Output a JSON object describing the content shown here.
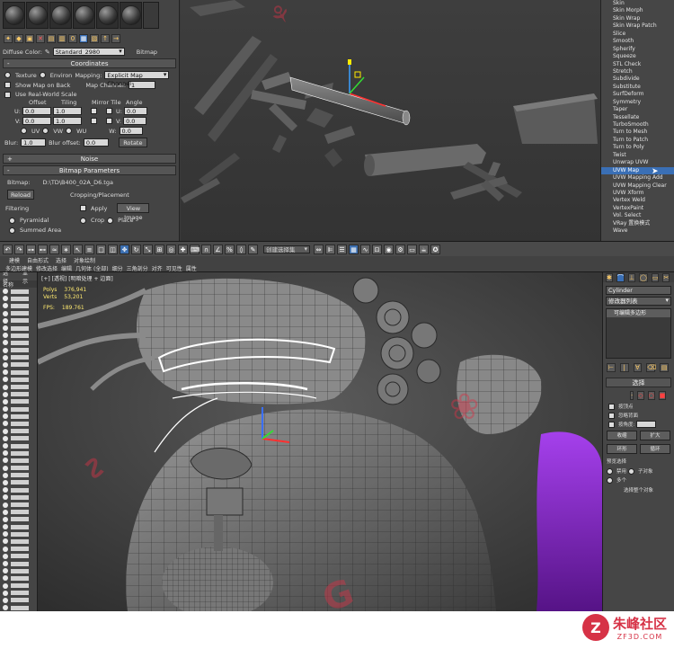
{
  "material_editor": {
    "diffuse_label": "Diffuse Color:",
    "map_name": "Standard_2980",
    "map_type": "Bitmap",
    "coordinates_title": "Coordinates",
    "texture_label": "Texture",
    "environ_label": "Environ",
    "mapping_label": "Mapping:",
    "mapping_value": "Explicit Map Channel",
    "show_map_label": "Show Map on Back",
    "map_channel_label": "Map Channel:",
    "map_channel_value": "1",
    "real_world_label": "Use Real-World Scale",
    "offset_label": "Offset",
    "tiling_label": "Tiling",
    "mirror_tile_label": "Mirror Tile",
    "angle_label": "Angle",
    "u_label": "U:",
    "v_label": "V:",
    "w_label": "W:",
    "u_offset": "0.0",
    "v_offset": "0.0",
    "u_tiling": "1.0",
    "v_tiling": "1.0",
    "u_angle": "0.0",
    "v_angle": "0.0",
    "w_angle": "0.0",
    "uv_label": "UV",
    "vw_label": "VW",
    "wu_label": "WU",
    "blur_label": "Blur:",
    "blur_value": "1.0",
    "blur_offset_label": "Blur offset:",
    "blur_offset_value": "0.0",
    "rotate_label": "Rotate",
    "noise_title": "Noise",
    "bitmap_params_title": "Bitmap Parameters",
    "bitmap_label": "Bitmap:",
    "bitmap_path": "D:\\TD\\B400_02A_D6.tga",
    "reload_label": "Reload",
    "cropping_label": "Cropping/Placement",
    "apply_label": "Apply",
    "view_image_label": "View Image",
    "crop_label": "Crop",
    "place_label": "Place",
    "filtering_label": "Filtering",
    "pyramidal_label": "Pyramidal",
    "summed_label": "Summed Area"
  },
  "modifier_list": {
    "items": [
      "Skin",
      "Skin Morph",
      "Skin Wrap",
      "Skin Wrap Patch",
      "Slice",
      "Smooth",
      "Spherify",
      "Squeeze",
      "STL Check",
      "Stretch",
      "Subdivide",
      "Substitute",
      "SurfDeform",
      "Symmetry",
      "Taper",
      "Tessellate",
      "TurboSmooth",
      "Turn to Mesh",
      "Turn to Patch",
      "Turn to Poly",
      "Twist",
      "Unwrap UVW",
      "UVW Map",
      "UVW Mapping Add",
      "UVW Mapping Clear",
      "UVW Xform",
      "Vertex Weld",
      "VertexPaint",
      "Vol. Select",
      "VRay 置换模式",
      "Wave"
    ],
    "selected_index": 22
  },
  "main_toolbar": {
    "selection_set_placeholder": "创建选择集"
  },
  "ribbon": {
    "top_tabs": [
      "建模",
      "自由形式",
      "选择",
      "对象绘制"
    ],
    "sub_tabs": [
      "多边形建模",
      "修改选择",
      "编辑",
      "几何体 (全部)",
      "细分",
      "三角剖分",
      "对齐",
      "可见性",
      "属性"
    ]
  },
  "scene_explorer": {
    "tabs": [
      "选择",
      "显示"
    ],
    "header": "名称",
    "row_count": 44
  },
  "viewport": {
    "label": "[+] [透视] [明暗处理 + 边面]",
    "stats_title": "Polys",
    "stats_value_label": "Verts",
    "fps_label": "FPS:",
    "fps_value": "189.761",
    "stats_total": "376,941",
    "stats_selected": "53,201"
  },
  "command_panel": {
    "object_name": "Cylinder",
    "modifier_dropdown": "修改器列表",
    "stack_item": "可编辑多边形",
    "selection_title": "选择",
    "by_vertex_label": "按顶点",
    "ignore_backfacing_label": "忽略背面",
    "by_angle_label": "按角度:",
    "shrink_label": "收缩",
    "grow_label": "扩大",
    "ring_label": "环形",
    "loop_label": "循环",
    "preview_label": "预览选择",
    "off_label": "禁用",
    "subobj_label": "子对象",
    "multi_label": "多个",
    "selected_label": "选择整个对象"
  },
  "watermark": {
    "site_name": "朱峰社区",
    "site_url": "ZF3D.COM"
  },
  "colors": {
    "accent_blue": "#3a6fb5",
    "watermark_red": "#d63246",
    "purple_object": "#8a2be2"
  }
}
